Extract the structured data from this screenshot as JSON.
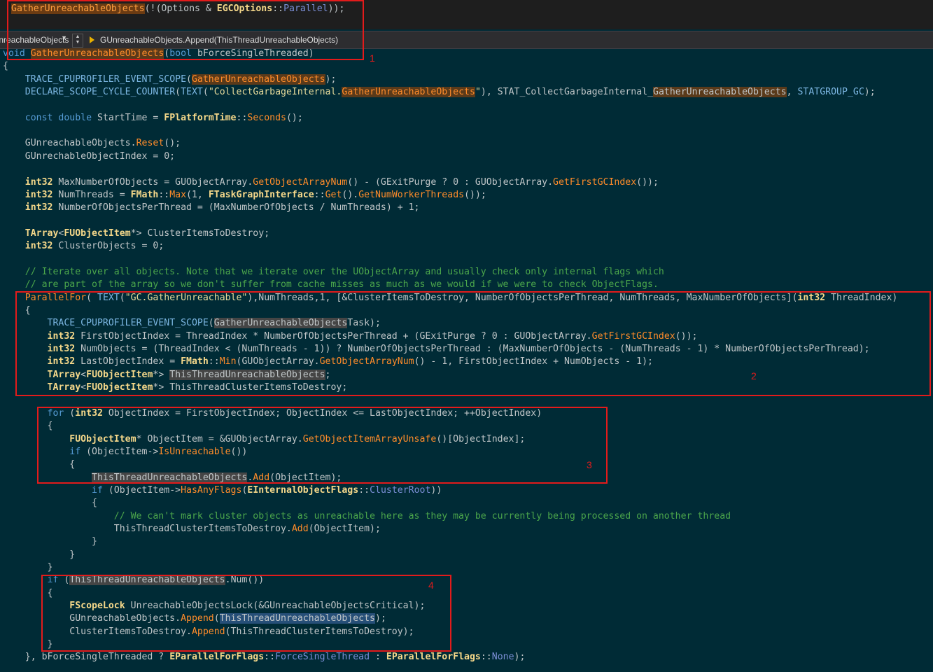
{
  "top_code": {
    "fn": "GatherUnreachableObjects",
    "rest1": "(!(Options & ",
    "enum_type": "EGCOptions",
    "sep": "::",
    "enum_val": "Parallel",
    "rest2": "));"
  },
  "nav": {
    "scope": "GatherUnreachableObjects",
    "member": "GUnreachableObjects.Append(ThisThreadUnreachableObjects)"
  },
  "annotations": [
    "1",
    "2",
    "3",
    "4"
  ],
  "colors": {
    "background": "#002b36",
    "annotation_red": "#e31b1b",
    "function": "#ff8c2a",
    "keyword": "#569cd6",
    "comment": "#4ba64b",
    "string": "#e6db9b"
  },
  "code": {
    "l0": [
      "void",
      " ",
      "GatherUnreachableObjects",
      "(",
      "bool",
      " bForceSingleThreaded)"
    ],
    "l1": [
      "{"
    ],
    "l2": [
      "    ",
      "TRACE_CPUPROFILER_EVENT_SCOPE",
      "(",
      "GatherUnreachableObjects",
      ");"
    ],
    "l3": [
      "    ",
      "DECLARE_SCOPE_CYCLE_COUNTER",
      "(",
      "TEXT",
      "(",
      "\"CollectGarbageInternal.",
      "GatherUnreachableObjects",
      "\"",
      "), STAT_CollectGarbageInternal_",
      "GatherUnreachableObjects",
      ", ",
      "STATGROUP_GC",
      ");"
    ],
    "l4": [
      ""
    ],
    "l5": [
      "    ",
      "const",
      " ",
      "double",
      " StartTime = ",
      "FPlatformTime",
      "::",
      "Seconds",
      "();"
    ],
    "l6": [
      ""
    ],
    "l7": [
      "    GUnreachableObjects.",
      "Reset",
      "();"
    ],
    "l8": [
      "    GUnrechableObjectIndex = 0;"
    ],
    "l9": [
      ""
    ],
    "l10": [
      "    ",
      "int32",
      " MaxNumberOfObjects = GUObjectArray.",
      "GetObjectArrayNum",
      "() - (GExitPurge ? 0 : GUObjectArray.",
      "GetFirstGCIndex",
      "());"
    ],
    "l11": [
      "    ",
      "int32",
      " NumThreads = ",
      "FMath",
      "::",
      "Max",
      "(1, ",
      "FTaskGraphInterface",
      "::",
      "Get",
      "().",
      "GetNumWorkerThreads",
      "());"
    ],
    "l12": [
      "    ",
      "int32",
      " NumberOfObjectsPerThread = (MaxNumberOfObjects / NumThreads) + 1;"
    ],
    "l13": [
      ""
    ],
    "l14": [
      "    ",
      "TArray",
      "<",
      "FUObjectItem",
      "*> ClusterItemsToDestroy;"
    ],
    "l15": [
      "    ",
      "int32",
      " ClusterObjects = 0;"
    ],
    "l16": [
      ""
    ],
    "l17": [
      "    // Iterate over all objects. Note that we iterate over the UObjectArray and usually check only internal flags which"
    ],
    "l18": [
      "    // are part of the array so we don't suffer from cache misses as much as we would if we were to check ObjectFlags."
    ],
    "l19": [
      "    ",
      "ParallelFor",
      "( ",
      "TEXT",
      "(",
      "\"GC.GatherUnreachable\"",
      "),NumThreads,1, [&ClusterItemsToDestroy, NumberOfObjectsPerThread, NumThreads, MaxNumberOfObjects](",
      "int32",
      " ThreadIndex)"
    ],
    "l20": [
      "    {"
    ],
    "l21": [
      "        ",
      "TRACE_CPUPROFILER_EVENT_SCOPE",
      "(",
      "GatherUnreachableObjects",
      "Task);"
    ],
    "l22": [
      "        ",
      "int32",
      " FirstObjectIndex = ThreadIndex * NumberOfObjectsPerThread + (GExitPurge ? 0 : GUObjectArray.",
      "GetFirstGCIndex",
      "());"
    ],
    "l23": [
      "        ",
      "int32",
      " NumObjects = (ThreadIndex < (NumThreads - 1)) ? NumberOfObjectsPerThread : (MaxNumberOfObjects - (NumThreads - 1) * NumberOfObjectsPerThread);"
    ],
    "l24": [
      "        ",
      "int32",
      " LastObjectIndex = ",
      "FMath",
      "::",
      "Min",
      "(GUObjectArray.",
      "GetObjectArrayNum",
      "() - 1, FirstObjectIndex + NumObjects - 1);"
    ],
    "l25": [
      "        ",
      "TArray",
      "<",
      "FUObjectItem",
      "*> ",
      "ThisThreadUnreachableObjects",
      ";"
    ],
    "l26": [
      "        ",
      "TArray",
      "<",
      "FUObjectItem",
      "*> ThisThreadClusterItemsToDestroy;"
    ],
    "l27": [
      ""
    ],
    "l28": [
      "        ",
      "for",
      " (",
      "int32",
      " ObjectIndex = FirstObjectIndex; ObjectIndex <= LastObjectIndex; ++ObjectIndex)"
    ],
    "l29": [
      "        {"
    ],
    "l30": [
      "            ",
      "FUObjectItem",
      "* ObjectItem = &GUObjectArray.",
      "GetObjectItemArrayUnsafe",
      "()[ObjectIndex];"
    ],
    "l31": [
      "            ",
      "if",
      " (ObjectItem->",
      "IsUnreachable",
      "())"
    ],
    "l32": [
      "            {"
    ],
    "l33": [
      "                ",
      "ThisThreadUnreachableObjects",
      ".",
      "Add",
      "(ObjectItem);"
    ],
    "l34": [
      "                ",
      "if",
      " (ObjectItem->",
      "HasAnyFlags",
      "(",
      "EInternalObjectFlags",
      "::",
      "ClusterRoot",
      "))"
    ],
    "l35": [
      "                {"
    ],
    "l36": [
      "                    // We can't mark cluster objects as unreachable here as they may be currently being processed on another thread"
    ],
    "l37": [
      "                    ThisThreadClusterItemsToDestroy.",
      "Add",
      "(ObjectItem);"
    ],
    "l38": [
      "                }"
    ],
    "l39": [
      "            }"
    ],
    "l40": [
      "        }"
    ],
    "l41": [
      "        ",
      "if",
      " (",
      "ThisThreadUnreachableObjects",
      ".Num())"
    ],
    "l42": [
      "        {"
    ],
    "l43": [
      "            ",
      "FScopeLock",
      " UnreachableObjectsLock(&GUnreachableObjectsCritical);"
    ],
    "l44": [
      "            GUnreachableObjects.",
      "Append",
      "(",
      "ThisThreadUnreachableObjects",
      ");"
    ],
    "l45": [
      "            ClusterItemsToDestroy.",
      "Append",
      "(ThisThreadClusterItemsToDestroy);"
    ],
    "l46": [
      "        }"
    ],
    "l47": [
      "    }, bForceSingleThreaded ? ",
      "EParallelForFlags",
      "::",
      "ForceSingleThread",
      " : ",
      "EParallelForFlags",
      "::",
      "None",
      ");"
    ]
  }
}
